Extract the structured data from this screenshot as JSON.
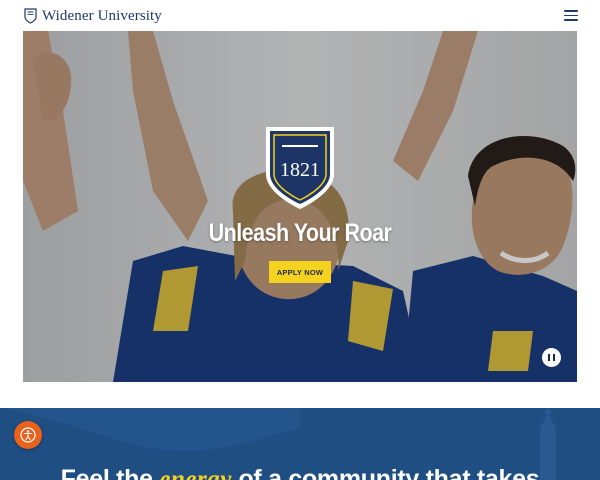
{
  "header": {
    "brand_name": "Widener University",
    "menu_icon": "hamburger-menu-icon"
  },
  "hero": {
    "crest_year": "1821",
    "title": "Unleash Your Roar",
    "apply_label": "APPLY NOW",
    "pause_icon": "pause-icon"
  },
  "band": {
    "text_before": "Feel the ",
    "text_accent": "energy",
    "text_after": " of a community that takes"
  },
  "accessibility": {
    "icon": "accessibility-icon"
  },
  "colors": {
    "navy": "#1e3a66",
    "gold": "#f5d21e",
    "band_blue": "#1f4e83",
    "accessibility_orange": "#e8621c"
  }
}
